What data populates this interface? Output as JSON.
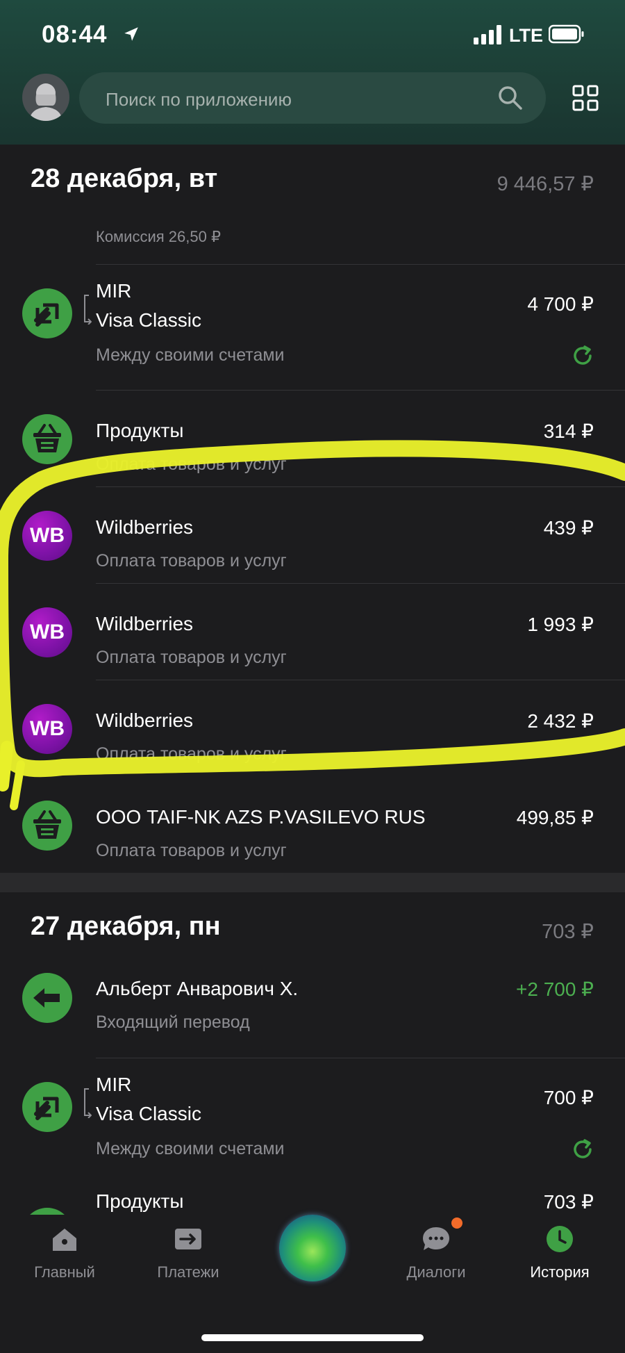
{
  "status_bar": {
    "time": "08:44",
    "network": "LTE"
  },
  "search": {
    "placeholder": "Поиск по приложению"
  },
  "days": [
    {
      "title": "28 декабря, вт",
      "sum": "9 446,57 ₽",
      "commission": "Комиссия 26,50 ₽",
      "transactions": [
        {
          "title_line1": "MIR",
          "title_line2": "Visa Classic",
          "subtitle": "Между своими счетами",
          "amount": "4 700 ₽",
          "icon": "transfer-icon"
        },
        {
          "title": "Продукты",
          "subtitle": "Оплата товаров и услуг",
          "amount": "314 ₽",
          "icon": "basket-icon"
        },
        {
          "title": "Wildberries",
          "subtitle": "Оплата товаров и услуг",
          "amount": "439 ₽",
          "icon": "wb-logo",
          "logo_text": "WB"
        },
        {
          "title": "Wildberries",
          "subtitle": "Оплата товаров и услуг",
          "amount": "1 993 ₽",
          "icon": "wb-logo",
          "logo_text": "WB"
        },
        {
          "title": "Wildberries",
          "subtitle": "Оплата товаров и услуг",
          "amount": "2 432 ₽",
          "icon": "wb-logo",
          "logo_text": "WB"
        },
        {
          "title": "ООО TAIF-NK AZS P.VASILEVO RUS",
          "subtitle": "Оплата товаров и услуг",
          "amount": "499,85 ₽",
          "icon": "basket-icon"
        }
      ]
    },
    {
      "title": "27 декабря, пн",
      "sum": "703 ₽",
      "transactions": [
        {
          "title": "Альберт Анварович Х.",
          "subtitle": "Входящий перевод",
          "amount": "+2 700 ₽",
          "icon": "arrow-left-icon"
        },
        {
          "title_line1": "MIR",
          "title_line2": "Visa Classic",
          "subtitle": "Между своими счетами",
          "amount": "700 ₽",
          "icon": "transfer-icon"
        },
        {
          "title": "Продукты",
          "amount": "703 ₽",
          "icon": "basket-icon"
        }
      ]
    }
  ],
  "tabs": [
    {
      "label": "Главный",
      "icon": "home-icon"
    },
    {
      "label": "Платежи",
      "icon": "payments-icon"
    },
    {
      "label": "",
      "icon": "assistant-orb"
    },
    {
      "label": "Диалоги",
      "icon": "chat-icon"
    },
    {
      "label": "История",
      "icon": "clock-icon",
      "active": true
    }
  ],
  "colors": {
    "accent_green": "#3fa045",
    "income_green": "#4caf50",
    "wb_purple": "#8a14b0",
    "highlight_yellow": "#e8f02a"
  }
}
